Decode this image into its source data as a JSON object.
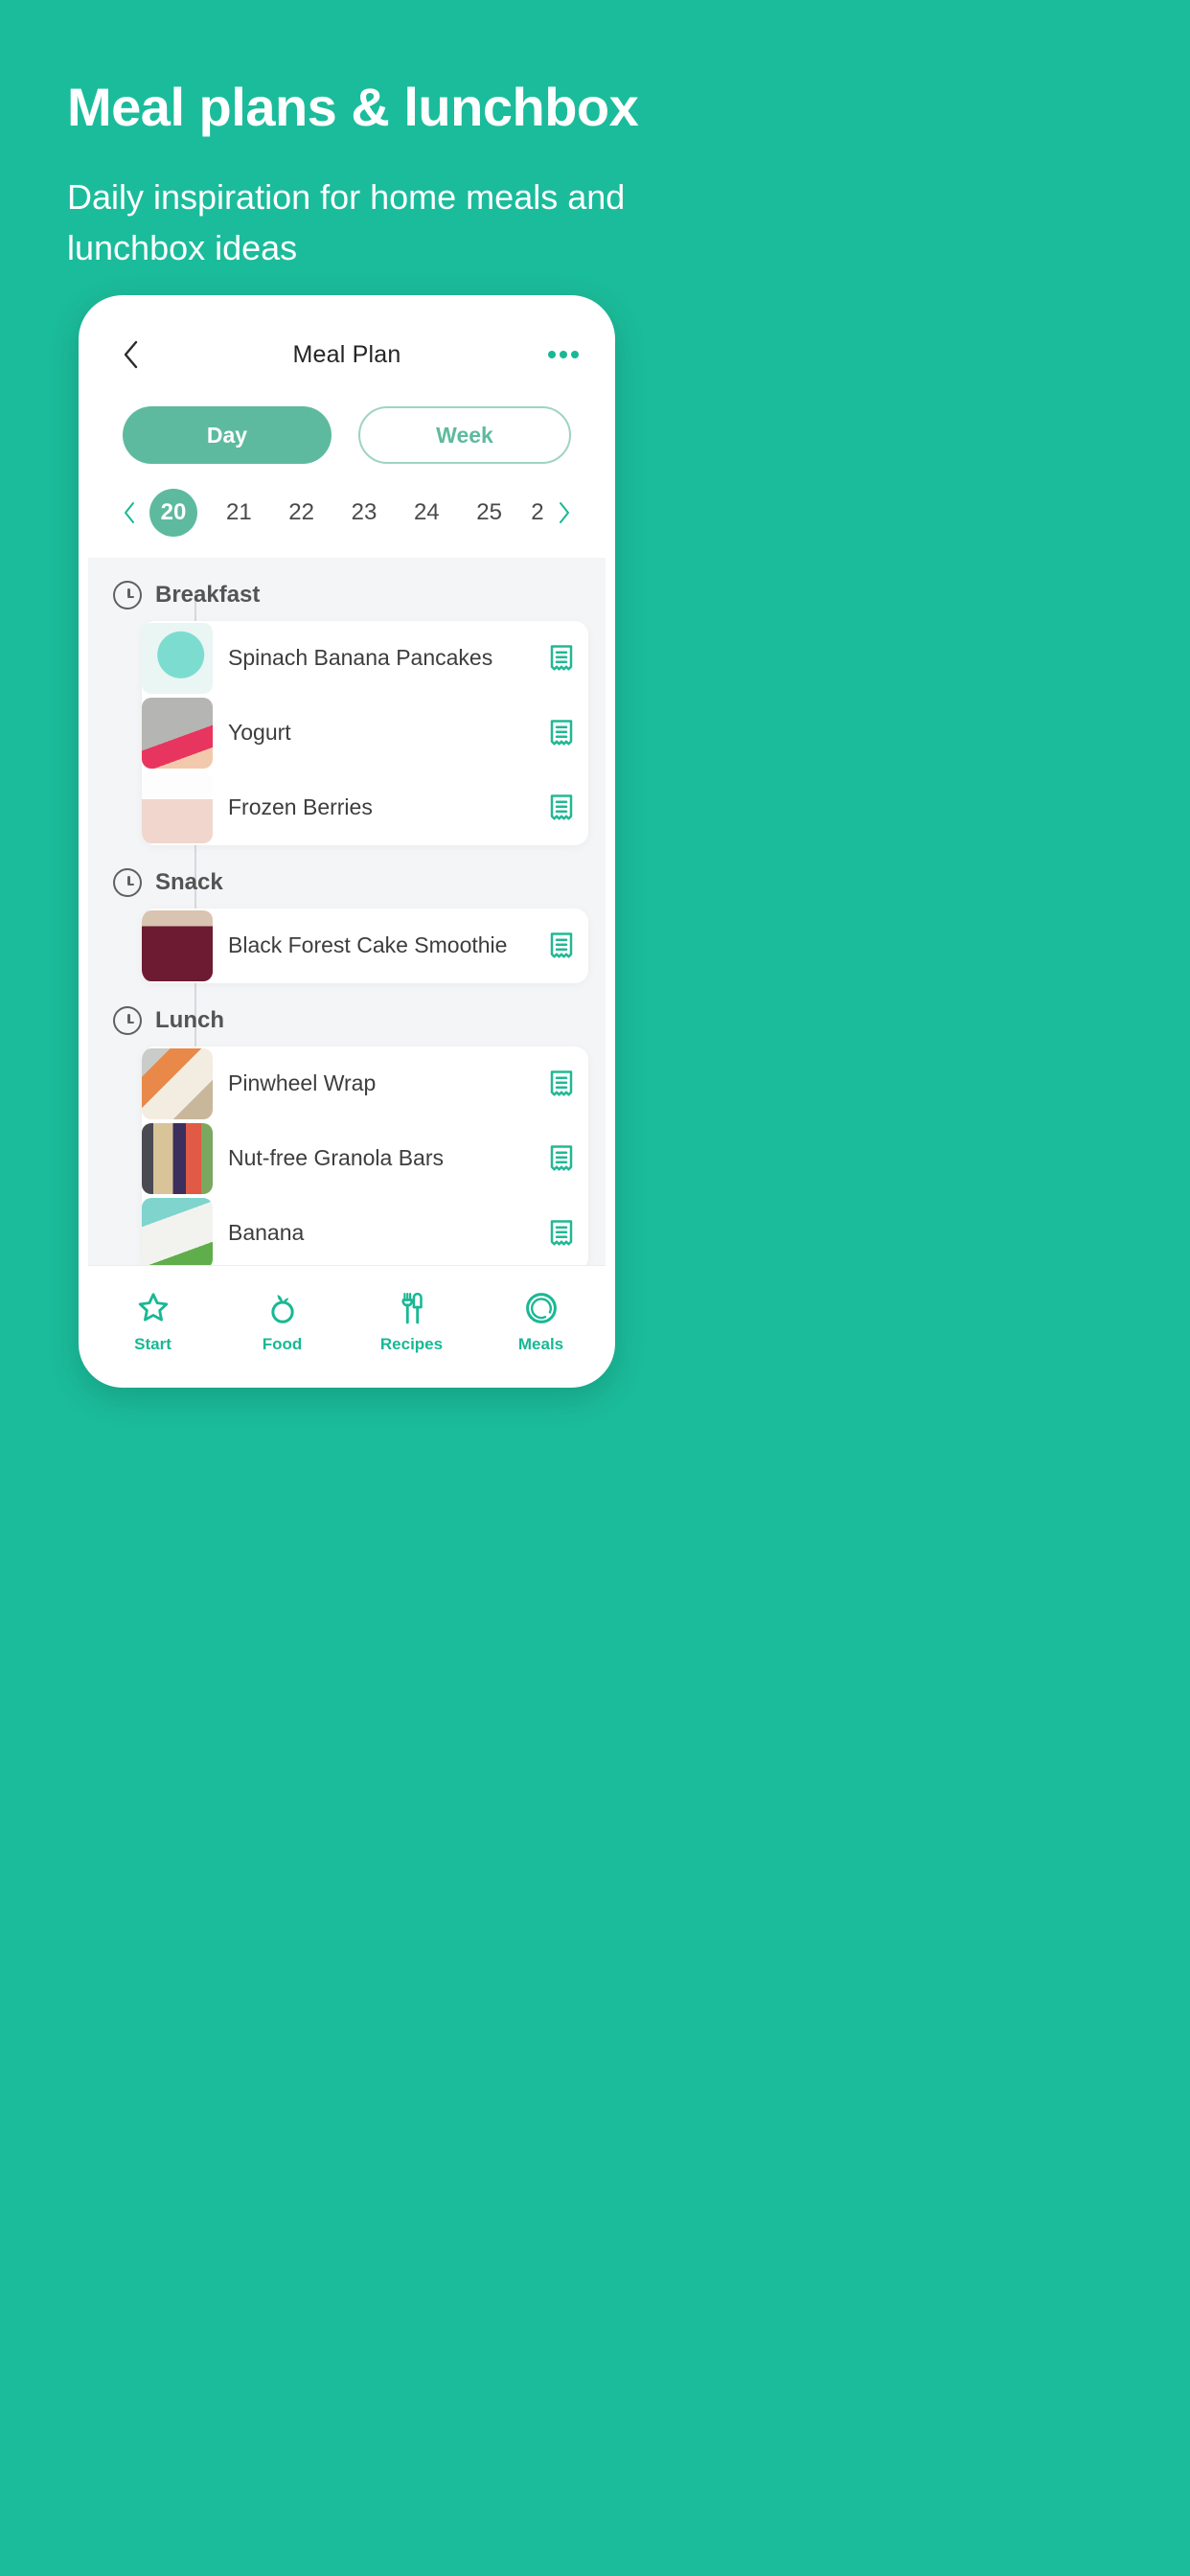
{
  "promo": {
    "title": "Meal plans & lunchbox",
    "subtitle": "Daily inspiration for home meals and lunchbox ideas"
  },
  "colors": {
    "brand_background": "#1BBC9B",
    "accent": "#18B894",
    "pill_active": "#5EBA9E",
    "screen_background": "#F4F5F7"
  },
  "app": {
    "header": {
      "title": "Meal Plan",
      "back_icon": "chevron-left-icon",
      "more_icon": "more-horizontal-icon"
    },
    "view_toggle": {
      "options": [
        "Day",
        "Week"
      ],
      "selected": "Day"
    },
    "date_strip": {
      "prev_icon": "chevron-left-icon",
      "next_icon": "chevron-right-icon",
      "dates": [
        "20",
        "21",
        "22",
        "23",
        "24",
        "25",
        "2"
      ],
      "selected": "20"
    },
    "sections": [
      {
        "label": "Breakfast",
        "icon": "clock-icon",
        "items": [
          {
            "title": "Spinach Banana Pancakes",
            "action_icon": "recipe-icon",
            "thumb": "pancakes-on-teal-plate"
          },
          {
            "title": "Yogurt",
            "action_icon": "recipe-icon",
            "thumb": "dough-balls-on-tray"
          },
          {
            "title": "Frozen Berries",
            "action_icon": "recipe-icon",
            "thumb": "berries-on-fingers"
          }
        ]
      },
      {
        "label": "Snack",
        "icon": "clock-icon",
        "items": [
          {
            "title": "Black Forest Cake Smoothie",
            "action_icon": "recipe-icon",
            "thumb": "two-smoothie-jars"
          }
        ]
      },
      {
        "label": "Lunch",
        "icon": "clock-icon",
        "items": [
          {
            "title": "Pinwheel Wrap",
            "action_icon": "recipe-icon",
            "thumb": "lunchbox-pinwheels"
          },
          {
            "title": "Nut-free Granola Bars",
            "action_icon": "recipe-icon",
            "thumb": "bento-box-granola"
          },
          {
            "title": "Banana",
            "action_icon": "recipe-icon",
            "thumb": "banana-on-board"
          }
        ]
      }
    ],
    "tabbar": [
      {
        "label": "Start",
        "icon": "star-icon"
      },
      {
        "label": "Food",
        "icon": "apple-icon"
      },
      {
        "label": "Recipes",
        "icon": "fork-knife-icon"
      },
      {
        "label": "Meals",
        "icon": "plate-icon"
      }
    ]
  }
}
